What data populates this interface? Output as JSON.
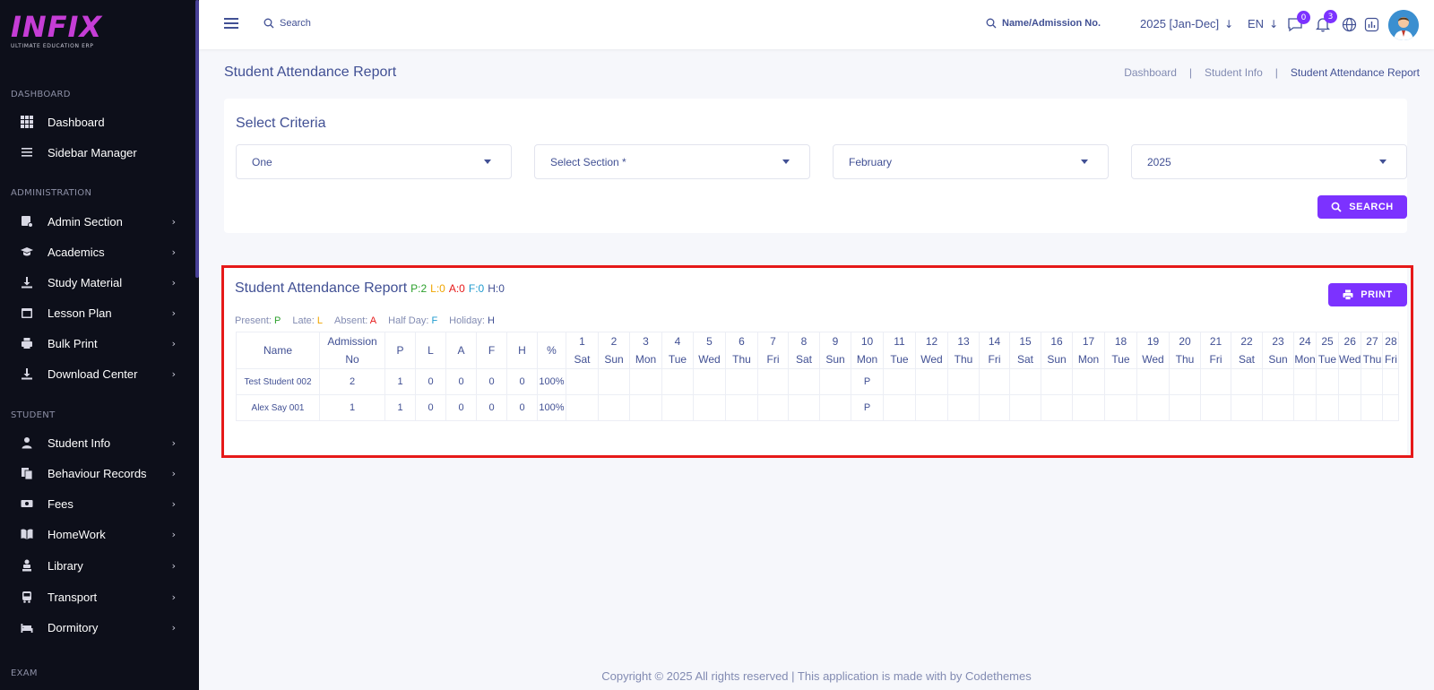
{
  "logo": {
    "text": "INFIX",
    "subtitle": "ULTIMATE EDUCATION ERP"
  },
  "sidebar": {
    "sections": [
      {
        "title": "DASHBOARD",
        "items": [
          {
            "label": "Dashboard",
            "icon": "grid-icon",
            "chevron": false
          },
          {
            "label": "Sidebar Manager",
            "icon": "list-icon",
            "chevron": false
          }
        ]
      },
      {
        "title": "ADMINISTRATION",
        "items": [
          {
            "label": "Admin Section",
            "icon": "admin-icon",
            "chevron": true
          },
          {
            "label": "Academics",
            "icon": "graduation-cap-icon",
            "chevron": true
          },
          {
            "label": "Study Material",
            "icon": "download-icon",
            "chevron": true
          },
          {
            "label": "Lesson Plan",
            "icon": "calendar-icon",
            "chevron": true
          },
          {
            "label": "Bulk Print",
            "icon": "printer-icon",
            "chevron": true
          },
          {
            "label": "Download Center",
            "icon": "download-icon",
            "chevron": true
          }
        ]
      },
      {
        "title": "STUDENT",
        "items": [
          {
            "label": "Student Info",
            "icon": "user-icon",
            "chevron": true
          },
          {
            "label": "Behaviour Records",
            "icon": "documents-icon",
            "chevron": true
          },
          {
            "label": "Fees",
            "icon": "money-icon",
            "chevron": true
          },
          {
            "label": "HomeWork",
            "icon": "book-icon",
            "chevron": true
          },
          {
            "label": "Library",
            "icon": "library-icon",
            "chevron": true
          },
          {
            "label": "Transport",
            "icon": "bus-icon",
            "chevron": true
          },
          {
            "label": "Dormitory",
            "icon": "bed-icon",
            "chevron": true
          }
        ]
      },
      {
        "title": "EXAM",
        "items": []
      }
    ]
  },
  "topbar": {
    "search_placeholder": "Search",
    "student_search": "Name/Admission No.",
    "session": "2025 [Jan-Dec]",
    "language": "EN",
    "messages_count": "0",
    "notifications_count": "3"
  },
  "page": {
    "title": "Student Attendance Report",
    "breadcrumb": [
      "Dashboard",
      "|",
      "Student Info",
      "|",
      "Student Attendance Report"
    ]
  },
  "criteria": {
    "title": "Select Criteria",
    "class_value": "One",
    "section_value": "Select Section *",
    "month_value": "February",
    "year_value": "2025",
    "search_label": "SEARCH"
  },
  "report": {
    "title": "Student Attendance Report",
    "stats": [
      {
        "text": "P:2",
        "color": "#2ca02c"
      },
      {
        "text": "L:0",
        "color": "#f0a500"
      },
      {
        "text": "A:0",
        "color": "#e61919"
      },
      {
        "text": "F:0",
        "color": "#1f9bcf"
      },
      {
        "text": "H:0",
        "color": "#415094"
      }
    ],
    "print_label": "PRINT",
    "legend": [
      {
        "label": "Present: ",
        "code": "P",
        "color": "#2ca02c"
      },
      {
        "label": "Late: ",
        "code": "L",
        "color": "#f0a500"
      },
      {
        "label": "Absent: ",
        "code": "A",
        "color": "#e61919"
      },
      {
        "label": "Half Day: ",
        "code": "F",
        "color": "#1f9bcf"
      },
      {
        "label": "Holiday: ",
        "code": "H",
        "color": "#415094"
      }
    ],
    "columns": [
      "Name",
      "Admission No",
      "P",
      "L",
      "A",
      "F",
      "H",
      "%"
    ],
    "days": [
      {
        "d": "1",
        "w": "Sat"
      },
      {
        "d": "2",
        "w": "Sun"
      },
      {
        "d": "3",
        "w": "Mon"
      },
      {
        "d": "4",
        "w": "Tue"
      },
      {
        "d": "5",
        "w": "Wed"
      },
      {
        "d": "6",
        "w": "Thu"
      },
      {
        "d": "7",
        "w": "Fri"
      },
      {
        "d": "8",
        "w": "Sat"
      },
      {
        "d": "9",
        "w": "Sun"
      },
      {
        "d": "10",
        "w": "Mon"
      },
      {
        "d": "11",
        "w": "Tue"
      },
      {
        "d": "12",
        "w": "Wed"
      },
      {
        "d": "13",
        "w": "Thu"
      },
      {
        "d": "14",
        "w": "Fri"
      },
      {
        "d": "15",
        "w": "Sat"
      },
      {
        "d": "16",
        "w": "Sun"
      },
      {
        "d": "17",
        "w": "Mon"
      },
      {
        "d": "18",
        "w": "Tue"
      },
      {
        "d": "19",
        "w": "Wed"
      },
      {
        "d": "20",
        "w": "Thu"
      },
      {
        "d": "21",
        "w": "Fri"
      },
      {
        "d": "22",
        "w": "Sat"
      },
      {
        "d": "23",
        "w": "Sun"
      },
      {
        "d": "24",
        "w": "Mon"
      },
      {
        "d": "25",
        "w": "Tue"
      },
      {
        "d": "26",
        "w": "Wed"
      },
      {
        "d": "27",
        "w": "Thu"
      },
      {
        "d": "28",
        "w": "Fri"
      }
    ],
    "rows": [
      {
        "name": "Test Student 002",
        "admission": "2",
        "p": "1",
        "l": "0",
        "a": "0",
        "f": "0",
        "h": "0",
        "pct": "100%",
        "marks": {
          "10": "P"
        }
      },
      {
        "name": "Alex Say 001",
        "admission": "1",
        "p": "1",
        "l": "0",
        "a": "0",
        "f": "0",
        "h": "0",
        "pct": "100%",
        "marks": {
          "10": "P"
        }
      }
    ]
  },
  "footer": {
    "text": "Copyright © 2025 All rights reserved | This application is made with by Codethemes"
  }
}
